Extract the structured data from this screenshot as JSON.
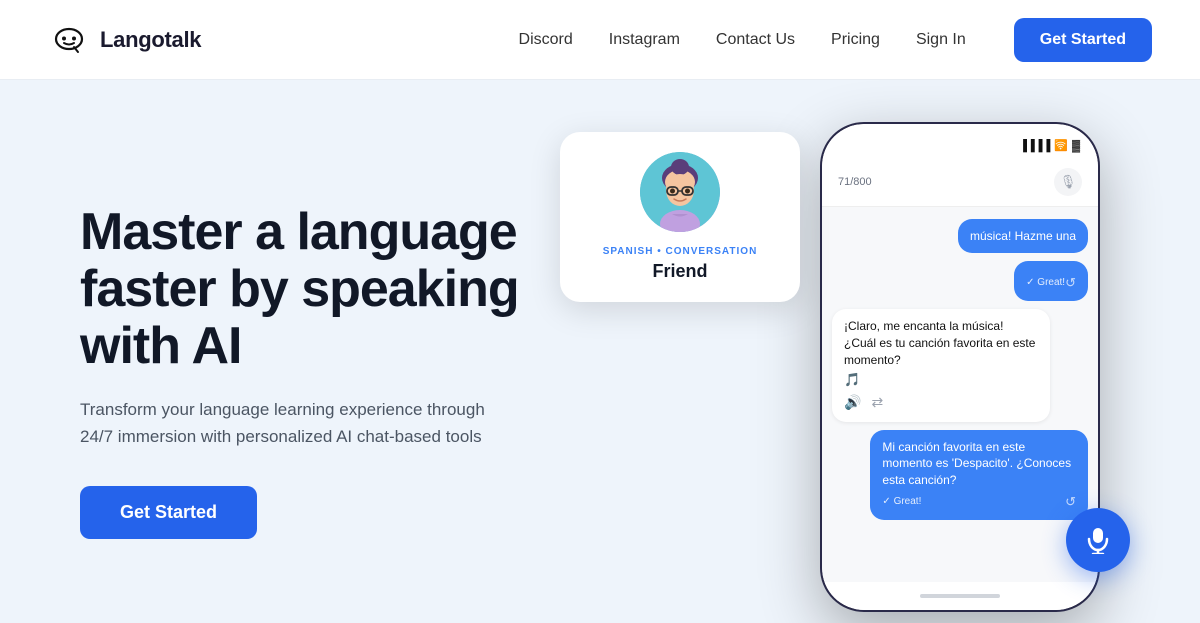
{
  "nav": {
    "logo_text": "Langotalk",
    "links": [
      {
        "label": "Discord",
        "key": "discord"
      },
      {
        "label": "Instagram",
        "key": "instagram"
      },
      {
        "label": "Contact Us",
        "key": "contact"
      },
      {
        "label": "Pricing",
        "key": "pricing"
      },
      {
        "label": "Sign In",
        "key": "signin"
      }
    ],
    "cta_label": "Get Started"
  },
  "hero": {
    "heading_line1": "Master a language",
    "heading_line2": "faster by speaking",
    "heading_line3": "with AI",
    "subtext": "Transform your language learning experience through 24/7 immersion with personalized AI chat-based tools",
    "cta_label": "Get Started"
  },
  "chat_card": {
    "lang_label": "SPANISH • CONVERSATION",
    "name": "Friend"
  },
  "phone": {
    "score": "71/800",
    "bubbles": [
      {
        "type": "blue",
        "text": "música! Hazme una",
        "has_footer": false
      },
      {
        "type": "blue",
        "text": "✓  Great!",
        "has_reload": true
      },
      {
        "type": "white",
        "text": "¡Claro, me encanta la música! ¿Cuál es tu canción favorita en este momento?",
        "has_note": true
      },
      {
        "type": "blue",
        "text": "Mi canción favorita en este momento es 'Despacito'. ¿Conoces esta canción?",
        "has_footer": true
      }
    ]
  },
  "colors": {
    "primary": "#2563eb",
    "background": "#eef4fb",
    "text_dark": "#111827",
    "text_muted": "#4b5563"
  }
}
